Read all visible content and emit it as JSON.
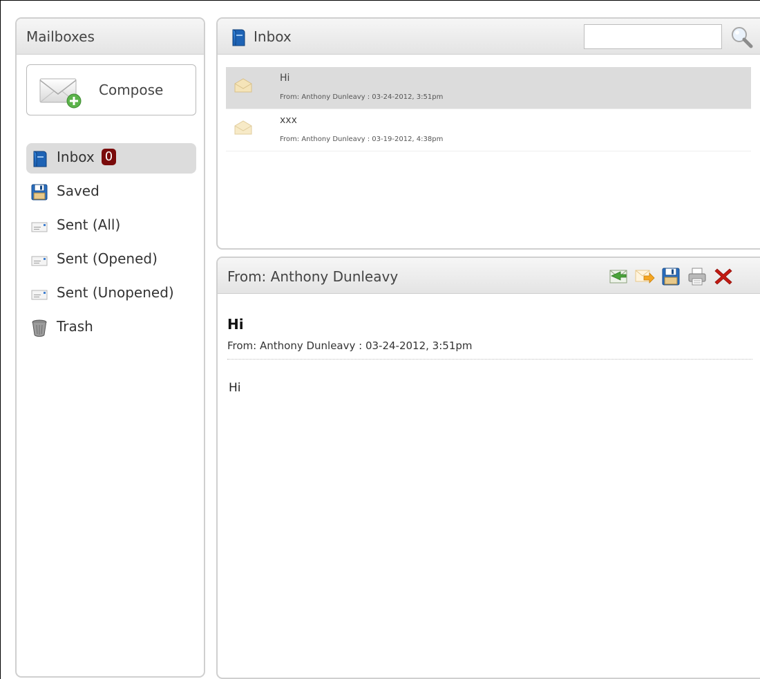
{
  "sidebar": {
    "title": "Mailboxes",
    "compose_label": "Compose",
    "items": [
      {
        "label": "Inbox",
        "badge": "0",
        "icon": "mailbox-icon",
        "active": true
      },
      {
        "label": "Saved",
        "icon": "floppy-disk-icon"
      },
      {
        "label": "Sent (All)",
        "icon": "sent-letter-icon"
      },
      {
        "label": "Sent (Opened)",
        "icon": "sent-letter-icon"
      },
      {
        "label": "Sent (Unopened)",
        "icon": "sent-letter-icon"
      },
      {
        "label": "Trash",
        "icon": "trash-can-icon"
      }
    ]
  },
  "inbox": {
    "title": "Inbox",
    "search": {
      "placeholder": "",
      "value": ""
    },
    "messages": [
      {
        "subject": "Hi",
        "meta": "From: Anthony Dunleavy : 03-24-2012, 3:51pm",
        "selected": true
      },
      {
        "subject": "xxx",
        "meta": "From: Anthony Dunleavy : 03-19-2012, 4:38pm",
        "selected": false
      }
    ]
  },
  "reader": {
    "header_title": "From: Anthony Dunleavy",
    "subject": "Hi",
    "from_line": "From: Anthony Dunleavy : 03-24-2012, 3:51pm",
    "body": "Hi",
    "toolbar": [
      "reply-icon",
      "forward-icon",
      "save-icon",
      "print-icon",
      "delete-icon"
    ]
  },
  "colors": {
    "badge": "#7a0b0b",
    "selected_row": "#dcdcdc",
    "header_gradient_top": "#f6f6f6",
    "header_gradient_bottom": "#e4e4e4",
    "delete": "#c21a12"
  }
}
